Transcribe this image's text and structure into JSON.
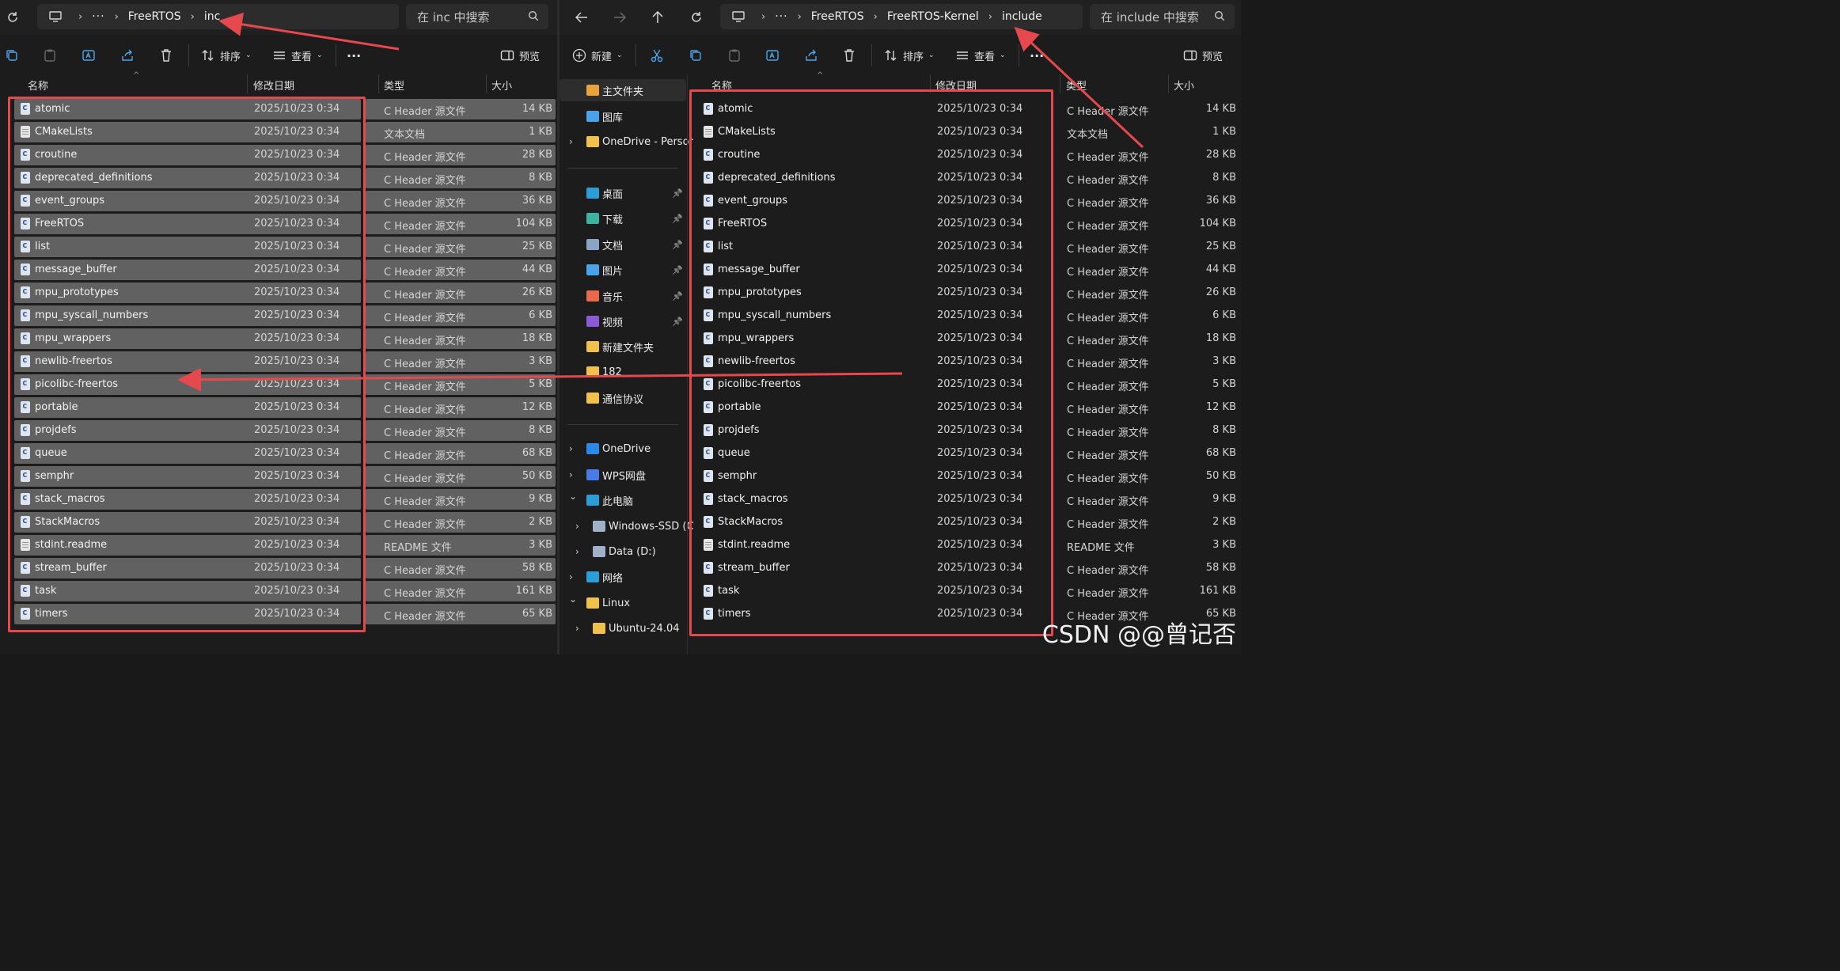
{
  "left": {
    "breadcrumb": [
      "FreeRTOS",
      "inc"
    ],
    "search_placeholder": "在 inc 中搜索",
    "toolbar": {
      "sort": "排序",
      "view": "查看",
      "more": "···",
      "preview": "预览"
    },
    "columns": {
      "name": "名称",
      "date": "修改日期",
      "type": "类型",
      "size": "大小"
    }
  },
  "right": {
    "breadcrumb": [
      "FreeRTOS",
      "FreeRTOS-Kernel",
      "include"
    ],
    "search_placeholder": "在 include 中搜索",
    "toolbar": {
      "new": "新建",
      "sort": "排序",
      "view": "查看",
      "more": "···",
      "preview": "预览"
    },
    "columns": {
      "name": "名称",
      "date": "修改日期",
      "type": "类型",
      "size": "大小"
    },
    "nav": [
      {
        "label": "主文件夹",
        "icon": "home-icon",
        "color": "#e8a33d"
      },
      {
        "label": "图库",
        "icon": "gallery-icon",
        "color": "#4aa3e8"
      },
      {
        "label": "OneDrive - Persor",
        "icon": "folder-icon",
        "color": "#f0c24b"
      },
      {
        "label": "桌面",
        "icon": "desktop-icon",
        "color": "#2b9ed8"
      },
      {
        "label": "下载",
        "icon": "download-icon",
        "color": "#3bb5a0"
      },
      {
        "label": "文档",
        "icon": "document-icon",
        "color": "#8aa4c8"
      },
      {
        "label": "图片",
        "icon": "pictures-icon",
        "color": "#4aa3e8"
      },
      {
        "label": "音乐",
        "icon": "music-icon",
        "color": "#e86a4a"
      },
      {
        "label": "视频",
        "icon": "video-icon",
        "color": "#8a5ad8"
      },
      {
        "label": "新建文件夹",
        "icon": "folder-icon",
        "color": "#f0c24b"
      },
      {
        "label": "182",
        "icon": "folder-icon",
        "color": "#f0c24b"
      },
      {
        "label": "通信协议",
        "icon": "folder-icon",
        "color": "#f0c24b"
      },
      {
        "label": "OneDrive",
        "icon": "cloud-icon",
        "color": "#2b8ae8"
      },
      {
        "label": "WPS网盘",
        "icon": "cloud-icon",
        "color": "#4a7ae8"
      },
      {
        "label": "此电脑",
        "icon": "computer-icon",
        "color": "#2b9ed8"
      },
      {
        "label": "Windows-SSD (C",
        "icon": "drive-icon",
        "color": "#9fb3c8"
      },
      {
        "label": "Data (D:)",
        "icon": "drive-icon",
        "color": "#9fb3c8"
      },
      {
        "label": "网络",
        "icon": "network-icon",
        "color": "#2b9ed8"
      },
      {
        "label": "Linux",
        "icon": "linux-icon",
        "color": "#f0c24b"
      },
      {
        "label": "Ubuntu-24.04",
        "icon": "folder-icon",
        "color": "#f0c24b"
      }
    ]
  },
  "files": [
    {
      "name": "atomic",
      "date": "2025/10/23 0:34",
      "type": "C Header 源文件",
      "size": "14 KB",
      "icon": "c"
    },
    {
      "name": "CMakeLists",
      "date": "2025/10/23 0:34",
      "type": "文本文档",
      "size": "1 KB",
      "icon": "txt"
    },
    {
      "name": "croutine",
      "date": "2025/10/23 0:34",
      "type": "C Header 源文件",
      "size": "28 KB",
      "icon": "c"
    },
    {
      "name": "deprecated_definitions",
      "date": "2025/10/23 0:34",
      "type": "C Header 源文件",
      "size": "8 KB",
      "icon": "c"
    },
    {
      "name": "event_groups",
      "date": "2025/10/23 0:34",
      "type": "C Header 源文件",
      "size": "36 KB",
      "icon": "c"
    },
    {
      "name": "FreeRTOS",
      "date": "2025/10/23 0:34",
      "type": "C Header 源文件",
      "size": "104 KB",
      "icon": "c"
    },
    {
      "name": "list",
      "date": "2025/10/23 0:34",
      "type": "C Header 源文件",
      "size": "25 KB",
      "icon": "c"
    },
    {
      "name": "message_buffer",
      "date": "2025/10/23 0:34",
      "type": "C Header 源文件",
      "size": "44 KB",
      "icon": "c"
    },
    {
      "name": "mpu_prototypes",
      "date": "2025/10/23 0:34",
      "type": "C Header 源文件",
      "size": "26 KB",
      "icon": "c"
    },
    {
      "name": "mpu_syscall_numbers",
      "date": "2025/10/23 0:34",
      "type": "C Header 源文件",
      "size": "6 KB",
      "icon": "c"
    },
    {
      "name": "mpu_wrappers",
      "date": "2025/10/23 0:34",
      "type": "C Header 源文件",
      "size": "18 KB",
      "icon": "c"
    },
    {
      "name": "newlib-freertos",
      "date": "2025/10/23 0:34",
      "type": "C Header 源文件",
      "size": "3 KB",
      "icon": "c"
    },
    {
      "name": "picolibc-freertos",
      "date": "2025/10/23 0:34",
      "type": "C Header 源文件",
      "size": "5 KB",
      "icon": "c"
    },
    {
      "name": "portable",
      "date": "2025/10/23 0:34",
      "type": "C Header 源文件",
      "size": "12 KB",
      "icon": "c"
    },
    {
      "name": "projdefs",
      "date": "2025/10/23 0:34",
      "type": "C Header 源文件",
      "size": "8 KB",
      "icon": "c"
    },
    {
      "name": "queue",
      "date": "2025/10/23 0:34",
      "type": "C Header 源文件",
      "size": "68 KB",
      "icon": "c"
    },
    {
      "name": "semphr",
      "date": "2025/10/23 0:34",
      "type": "C Header 源文件",
      "size": "50 KB",
      "icon": "c"
    },
    {
      "name": "stack_macros",
      "date": "2025/10/23 0:34",
      "type": "C Header 源文件",
      "size": "9 KB",
      "icon": "c"
    },
    {
      "name": "StackMacros",
      "date": "2025/10/23 0:34",
      "type": "C Header 源文件",
      "size": "2 KB",
      "icon": "c"
    },
    {
      "name": "stdint.readme",
      "date": "2025/10/23 0:34",
      "type": "README 文件",
      "size": "3 KB",
      "icon": "txt"
    },
    {
      "name": "stream_buffer",
      "date": "2025/10/23 0:34",
      "type": "C Header 源文件",
      "size": "58 KB",
      "icon": "c"
    },
    {
      "name": "task",
      "date": "2025/10/23 0:34",
      "type": "C Header 源文件",
      "size": "161 KB",
      "icon": "c"
    },
    {
      "name": "timers",
      "date": "2025/10/23 0:34",
      "type": "C Header 源文件",
      "size": "65 KB",
      "icon": "c"
    }
  ],
  "watermark": "CSDN @@曾记否",
  "colors": {
    "annotation_red": "#e5484d",
    "selection_gray": "#616161"
  }
}
